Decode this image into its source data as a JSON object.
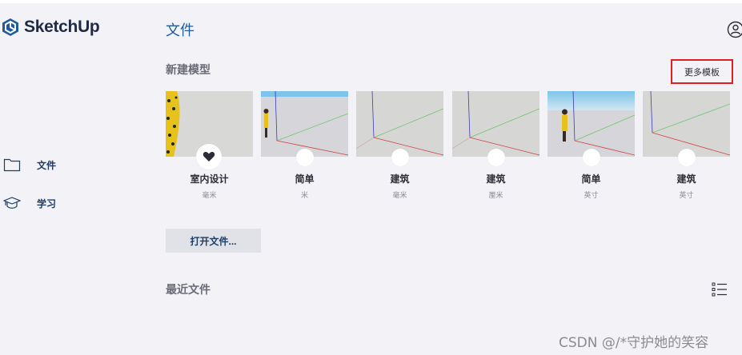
{
  "app": {
    "name": "SketchUp",
    "brand_color": "#1f5c99"
  },
  "sidebar": {
    "items": [
      {
        "label": "文件",
        "icon": "folder-icon"
      },
      {
        "label": "学习",
        "icon": "graduation-cap-icon"
      }
    ]
  },
  "header": {
    "title": "文件",
    "account_icon": "user-account-icon"
  },
  "new_model": {
    "title": "新建模型",
    "more_templates": "更多模板",
    "templates": [
      {
        "name": "室内设计",
        "unit": "毫米",
        "favorite": true,
        "has_figure": true
      },
      {
        "name": "简单",
        "unit": "米",
        "favorite": false,
        "has_figure": true
      },
      {
        "name": "建筑",
        "unit": "毫米",
        "favorite": false,
        "has_figure": false
      },
      {
        "name": "建筑",
        "unit": "厘米",
        "favorite": false,
        "has_figure": false
      },
      {
        "name": "简单",
        "unit": "英寸",
        "favorite": false,
        "has_figure": true
      },
      {
        "name": "建筑",
        "unit": "英寸",
        "favorite": false,
        "has_figure": false
      }
    ]
  },
  "open_file": {
    "label": "打开文件..."
  },
  "recent": {
    "title": "最近文件",
    "view_icon": "list-view-icon"
  },
  "watermark": "CSDN @/*守护她的笑容"
}
